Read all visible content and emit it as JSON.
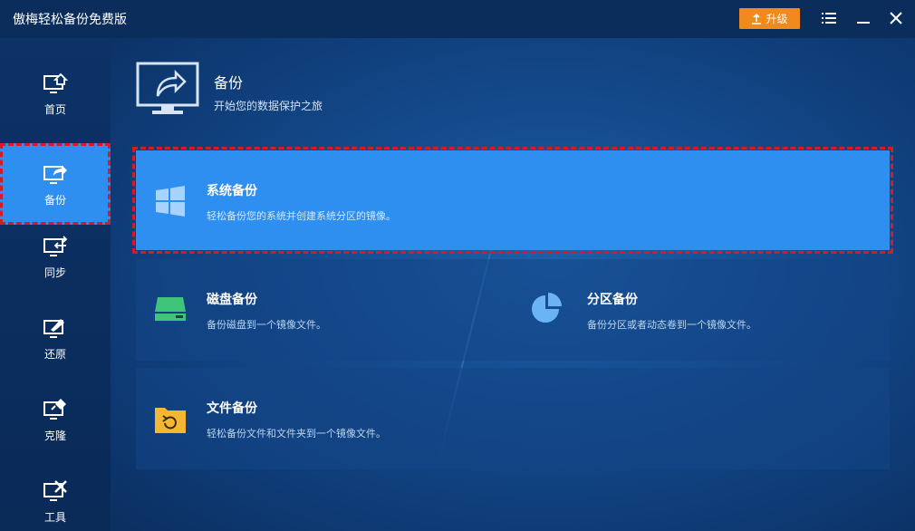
{
  "app": {
    "title": "傲梅轻松备份免费版"
  },
  "titlebar": {
    "upgrade_label": "升级"
  },
  "sidebar": {
    "items": [
      {
        "label": "首页"
      },
      {
        "label": "备份"
      },
      {
        "label": "同步"
      },
      {
        "label": "还原"
      },
      {
        "label": "克隆"
      },
      {
        "label": "工具"
      }
    ]
  },
  "header": {
    "title": "备份",
    "subtitle": "开始您的数据保护之旅"
  },
  "cards": {
    "system": {
      "title": "系统备份",
      "desc": "轻松备份您的系统并创建系统分区的镜像。"
    },
    "disk": {
      "title": "磁盘备份",
      "desc": "备份磁盘到一个镜像文件。"
    },
    "partition": {
      "title": "分区备份",
      "desc": "备份分区或者动态卷到一个镜像文件。"
    },
    "file": {
      "title": "文件备份",
      "desc": "轻松备份文件和文件夹到一个镜像文件。"
    }
  },
  "colors": {
    "accent": "#2f8ff0",
    "highlight_border": "#d91a24",
    "upgrade": "#f08a1c",
    "disk_icon": "#3ec57a",
    "folder_icon": "#f5b731"
  }
}
